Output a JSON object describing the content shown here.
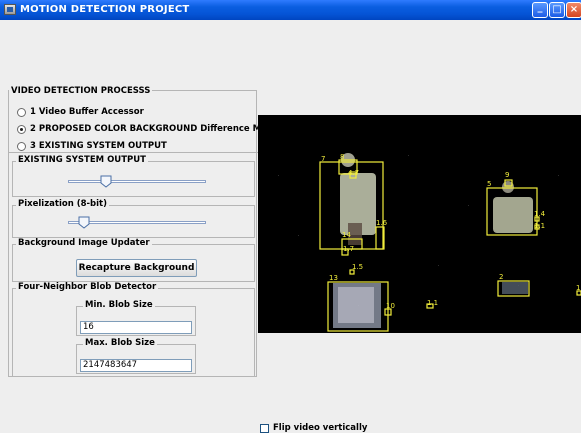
{
  "window": {
    "title": "MOTION DETECTION PROJECT"
  },
  "detection": {
    "title": "VIDEO DETECTION PROCESSS",
    "options": [
      {
        "label": "1 Video Buffer Accessor",
        "checked": false
      },
      {
        "label": "2 PROPOSED COLOR BACKGROUND Difference Model",
        "checked": true
      },
      {
        "label": "3 EXISTING SYSTEM OUTPUT",
        "checked": false
      }
    ]
  },
  "existing_output": {
    "title": "EXISTING SYSTEM OUTPUT",
    "slider_value_fraction": 0.25
  },
  "pixelization": {
    "title": "Pixelization (8-bit)",
    "slider_value_fraction": 0.08
  },
  "background_updater": {
    "title": "Background Image Updater",
    "button_label": "Recapture Background"
  },
  "blob_detector": {
    "title": "Four-Neighbor Blob Detector",
    "min_label": "Min. Blob Size",
    "min_value": "16",
    "max_label": "Max. Blob Size",
    "max_value": "2147483647"
  },
  "video": {
    "blob_labels": [
      "7",
      "8",
      "4.7",
      "1.6",
      "14",
      "1.7",
      "1.5",
      "13",
      "10",
      "1.1",
      "5",
      "9",
      "1.4",
      "1.1",
      "2",
      "1"
    ]
  },
  "flip": {
    "label": "Flip video vertically",
    "checked": false
  },
  "colors": {
    "titlebar": "#0554d6",
    "blob_box": "#f2ee3c",
    "video_bg": "#000000"
  }
}
